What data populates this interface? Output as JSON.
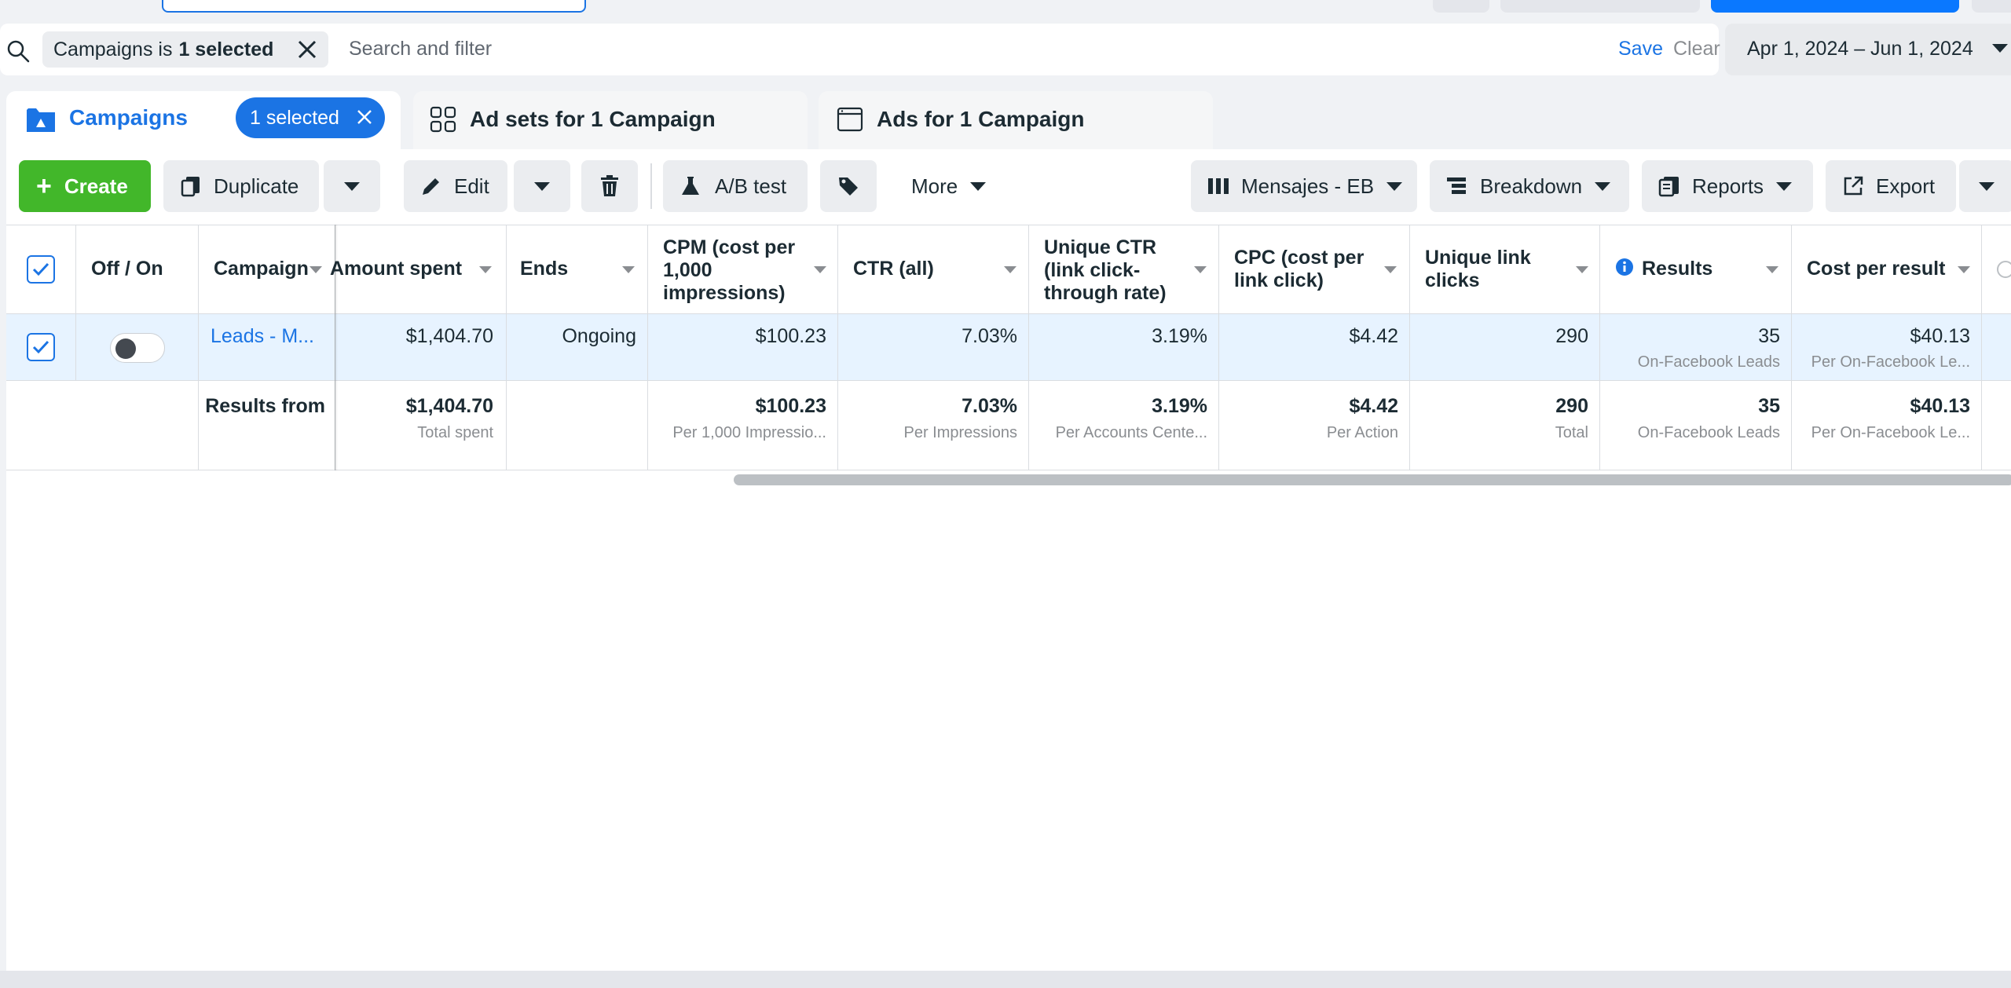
{
  "filter_bar": {
    "chip_prefix": "Campaigns is",
    "chip_value": "1 selected",
    "search_placeholder": "Search and filter",
    "save_label": "Save",
    "clear_label": "Clear",
    "date_range": "Apr 1, 2024 – Jun 1, 2024"
  },
  "tabs": {
    "campaigns": "Campaigns",
    "selected_pill": "1 selected",
    "ad_sets": "Ad sets for 1 Campaign",
    "ads": "Ads for 1 Campaign"
  },
  "toolbar": {
    "create": "Create",
    "duplicate": "Duplicate",
    "edit": "Edit",
    "ab_test": "A/B test",
    "more": "More",
    "columns": "Mensajes - EB",
    "breakdown": "Breakdown",
    "reports": "Reports",
    "export": "Export"
  },
  "table": {
    "headers": {
      "off_on": "Off / On",
      "campaign": "Campaign",
      "amount_spent": "Amount spent",
      "ends": "Ends",
      "cpm": "CPM (cost per 1,000 impressions)",
      "ctr_all": "CTR (all)",
      "unique_ctr": "Unique CTR (link click-through rate)",
      "cpc": "CPC (cost per link click)",
      "unique_link_clicks": "Unique link clicks",
      "results": "Results",
      "cost_per_result": "Cost per result"
    },
    "row": {
      "campaign_name": "Leads - M...",
      "amount_spent": "$1,404.70",
      "ends": "Ongoing",
      "cpm": "$100.23",
      "ctr_all": "7.03%",
      "unique_ctr": "3.19%",
      "cpc": "$4.42",
      "unique_link_clicks": "290",
      "results": "35",
      "results_sub": "On-Facebook Leads",
      "cost_per_result": "$40.13",
      "cost_per_result_sub": "Per On-Facebook Le..."
    },
    "totals": {
      "label": "Results from",
      "amount_spent": "$1,404.70",
      "amount_spent_sub": "Total spent",
      "cpm": "$100.23",
      "cpm_sub": "Per 1,000 Impressio...",
      "ctr_all": "7.03%",
      "ctr_all_sub": "Per Impressions",
      "unique_ctr": "3.19%",
      "unique_ctr_sub": "Per Accounts Cente...",
      "cpc": "$4.42",
      "cpc_sub": "Per Action",
      "unique_link_clicks": "290",
      "unique_link_clicks_sub": "Total",
      "results": "35",
      "results_sub": "On-Facebook Leads",
      "cost_per_result": "$40.13",
      "cost_per_result_sub": "Per On-Facebook Le..."
    }
  },
  "colors": {
    "accent": "#1b74e4",
    "create_green": "#42b72a",
    "selected_row": "#e7f3ff"
  }
}
